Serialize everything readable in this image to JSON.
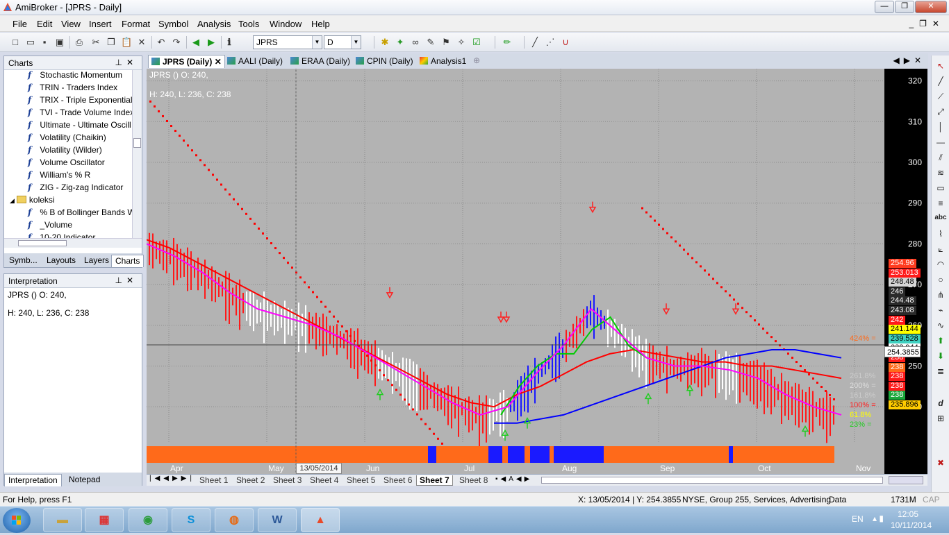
{
  "window": {
    "title": "AmiBroker - [JPRS - Daily]",
    "minimize": "—",
    "maximize": "❐",
    "close": "✕"
  },
  "menu": [
    "File",
    "Edit",
    "View",
    "Insert",
    "Format",
    "Symbol",
    "Analysis",
    "Tools",
    "Window",
    "Help"
  ],
  "toolbar": {
    "symbol_value": "JPRS",
    "interval_value": "D"
  },
  "charts_panel": {
    "title": "Charts",
    "items": [
      {
        "type": "formula",
        "label": "Stochastic Momentum"
      },
      {
        "type": "formula",
        "label": "TRIN - Traders Index"
      },
      {
        "type": "formula",
        "label": "TRIX - Triple Exponential"
      },
      {
        "type": "formula",
        "label": "TVI - Trade Volume Index"
      },
      {
        "type": "formula",
        "label": "Ultimate - Ultimate Oscill"
      },
      {
        "type": "formula",
        "label": "Volatility (Chaikin)"
      },
      {
        "type": "formula",
        "label": "Volatility (Wilder)"
      },
      {
        "type": "formula",
        "label": "Volume Oscillator"
      },
      {
        "type": "formula",
        "label": "William's % R"
      },
      {
        "type": "formula",
        "label": "ZIG - Zig-zag Indicator"
      },
      {
        "type": "folder",
        "label": "koleksi"
      },
      {
        "type": "formula",
        "label": "% B of Bollinger Bands W"
      },
      {
        "type": "formula",
        "label": "_Volume"
      },
      {
        "type": "formula",
        "label": "10-20 Indicator"
      }
    ],
    "tabs": [
      "Symb...",
      "Layouts",
      "Layers",
      "Charts"
    ],
    "active_tab": "Charts"
  },
  "interpretation_panel": {
    "title": "Interpretation",
    "line1": "JPRS () O: 240,",
    "line2": "H: 240, L: 236, C: 238",
    "tabs": [
      "Interpretation",
      "Notepad"
    ]
  },
  "doc_tabs": [
    {
      "label": "JPRS (Daily)",
      "active": true
    },
    {
      "label": "AALI (Daily)",
      "active": false
    },
    {
      "label": "ERAA (Daily)",
      "active": false
    },
    {
      "label": "CPIN (Daily)",
      "active": false
    },
    {
      "label": "Analysis1",
      "active": false
    }
  ],
  "chart": {
    "header_line1": "JPRS () O: 240,",
    "header_line2": "H: 240, L: 236, C: 238",
    "date_tooltip": "13/05/2014",
    "cursor_price": "254.3855",
    "price_labels": [
      {
        "text": "254.96",
        "bg": "#ff3b1f",
        "fg": "#ffffff"
      },
      {
        "text": "253.013",
        "bg": "#ff1a1a",
        "fg": "#ffffff"
      },
      {
        "text": "248.48",
        "bg": "#d6d6d6",
        "fg": "#000000"
      },
      {
        "text": "246",
        "bg": "#2a2a2a",
        "fg": "#ffffff"
      },
      {
        "text": "244.48",
        "bg": "#2a2a2a",
        "fg": "#ffffff"
      },
      {
        "text": "243.08",
        "bg": "#2a2a2a",
        "fg": "#ffffff"
      },
      {
        "text": "242",
        "bg": "#ff1a1a",
        "fg": "#ffffff"
      },
      {
        "text": "241.144",
        "bg": "#ffff00",
        "fg": "#000000"
      },
      {
        "text": "239.528",
        "bg": "#3fd0c0",
        "fg": "#000000"
      },
      {
        "text": "238.944",
        "bg": "#ffffff",
        "fg": "#000000"
      },
      {
        "text": "238",
        "bg": "#ff1a1a",
        "fg": "#ffffff"
      },
      {
        "text": "238",
        "bg": "#ff6a1a",
        "fg": "#ffffff"
      },
      {
        "text": "238",
        "bg": "#ff1a1a",
        "fg": "#ffffff"
      },
      {
        "text": "238",
        "bg": "#ff1a1a",
        "fg": "#ffffff"
      },
      {
        "text": "238",
        "bg": "#1aa83a",
        "fg": "#ffffff"
      },
      {
        "text": "235.896",
        "bg": "#ffcc00",
        "fg": "#000000"
      }
    ],
    "fib_labels": [
      "424% = ",
      "261.8%",
      "200% = ",
      "161.8% ",
      "100% = ",
      "61.8%",
      "23% = "
    ]
  },
  "chart_data": {
    "type": "line",
    "title": "",
    "xlabel": "",
    "ylabel": "",
    "x_tick_labels": [
      "Apr",
      "May",
      "Jun",
      "Jul",
      "Aug",
      "Sep",
      "Oct",
      "Nov"
    ],
    "y_tick_labels": [
      "320",
      "310",
      "300",
      "290",
      "280",
      "270",
      "260",
      "250",
      "240"
    ],
    "ylim": [
      231,
      323
    ],
    "log_scale": false,
    "grid": true,
    "series": [
      {
        "name": "",
        "color": "#ff0000",
        "values": [
          281,
          279,
          276,
          273,
          270,
          267,
          264,
          261,
          258,
          255,
          252,
          249,
          246,
          243,
          241,
          240,
          243,
          245,
          248,
          251,
          253,
          254,
          253,
          252,
          251,
          251,
          250,
          250,
          249,
          248,
          247
        ]
      },
      {
        "name": "",
        "color": "#0000ff",
        "values": [
          236,
          236,
          237,
          238,
          240,
          242,
          244,
          246,
          248,
          250,
          252,
          253,
          254,
          254,
          253,
          252
        ]
      },
      {
        "name": "",
        "color": "#00cc00",
        "values": [
          238,
          245,
          250,
          253,
          253,
          259,
          262,
          255,
          252
        ]
      },
      {
        "name": "",
        "color": "#ff00ff",
        "values": [
          280,
          277,
          273,
          268,
          264,
          262,
          260,
          257,
          253,
          249,
          245,
          241,
          238,
          240,
          248,
          255,
          264,
          258,
          252,
          250,
          250,
          249,
          247,
          243,
          240,
          238
        ]
      }
    ]
  },
  "sheets": [
    "Sheet 1",
    "Sheet 2",
    "Sheet 3",
    "Sheet 4",
    "Sheet 5",
    "Sheet 6",
    "Sheet 7",
    "Sheet 8"
  ],
  "active_sheet": "Sheet 7",
  "status": {
    "help": "For Help, press F1",
    "coords": "X: 13/05/2014  |  Y: 254.3855",
    "exchange": "NYSE, Group 255, Services, Advertising",
    "mode": "Data",
    "memory": "1731M",
    "cap": "CAP"
  },
  "taskbar": {
    "lang": "EN",
    "time": "12:05",
    "date": "10/11/2014"
  }
}
